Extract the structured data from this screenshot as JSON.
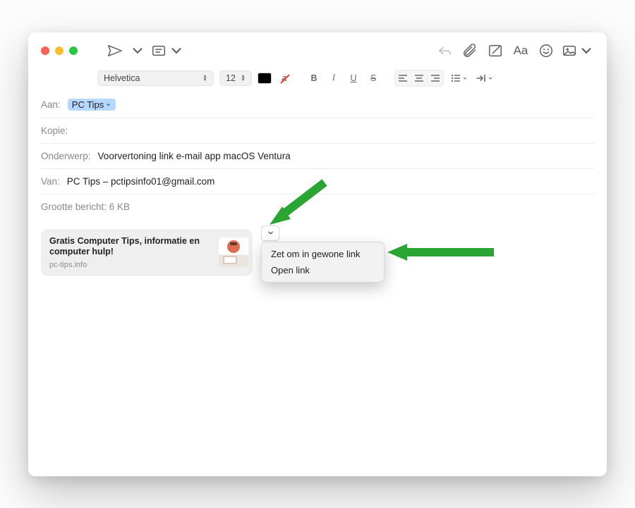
{
  "toolbar": {
    "aa_label": "Aa"
  },
  "format": {
    "font_name": "Helvetica",
    "font_size": "12",
    "bold": "B",
    "italic": "I",
    "underline": "U",
    "strike": "S"
  },
  "fields": {
    "to_label": "Aan:",
    "to_token": "PC Tips",
    "cc_label": "Kopie:",
    "subject_label": "Onderwerp:",
    "subject_value": "Voorvertoning link e-mail app macOS Ventura",
    "from_label": "Van:",
    "from_value": "PC Tips – pctipsinfo01@gmail.com",
    "size_label": "Grootte bericht: 6 KB"
  },
  "link_card": {
    "title": "Gratis Computer Tips, informatie en computer hulp!",
    "domain": "pc-tips.info"
  },
  "context_menu": {
    "items": [
      "Zet om in gewone link",
      "Open link"
    ]
  }
}
